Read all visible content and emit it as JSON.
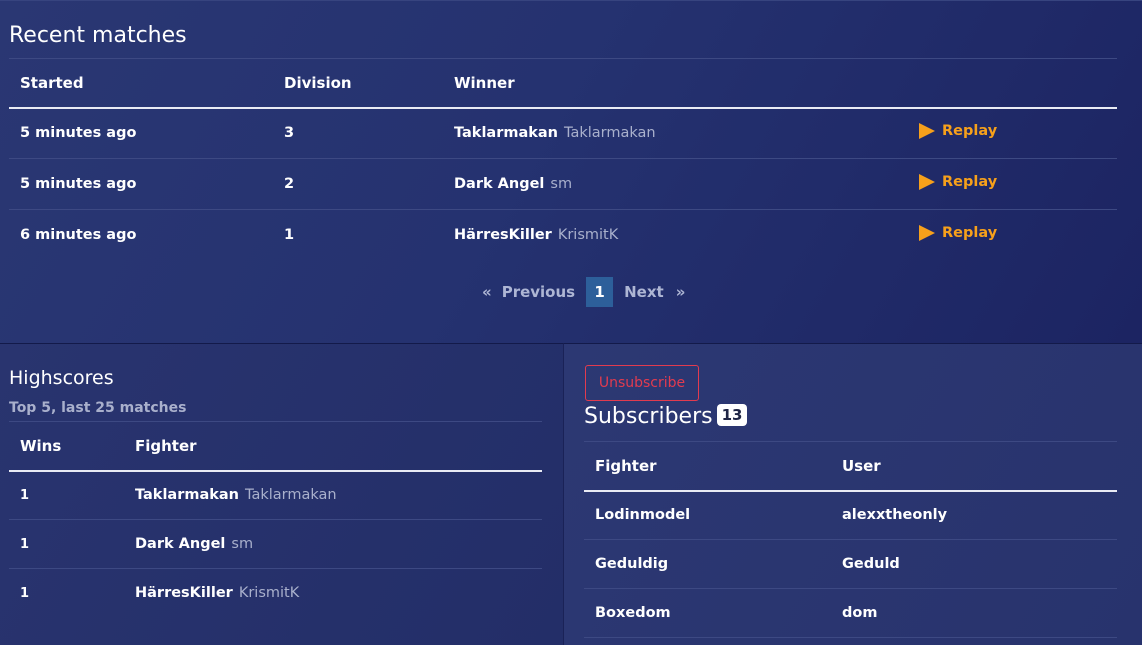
{
  "recent": {
    "title": "Recent matches",
    "columns": {
      "started": "Started",
      "division": "Division",
      "winner": "Winner"
    },
    "rows": [
      {
        "started": "5 minutes ago",
        "division": "3",
        "fighter": "Taklarmakan",
        "user": "Taklarmakan",
        "action": "Replay"
      },
      {
        "started": "5 minutes ago",
        "division": "2",
        "fighter": "Dark Angel",
        "user": "sm",
        "action": "Replay"
      },
      {
        "started": "6 minutes ago",
        "division": "1",
        "fighter": "HärresKiller",
        "user": "KrismitK",
        "action": "Replay"
      }
    ],
    "pagination": {
      "first": "«",
      "previous": "Previous",
      "current": "1",
      "next": "Next",
      "last": "»"
    }
  },
  "highscores": {
    "title": "Highscores",
    "subtitle": "Top 5, last 25 matches",
    "columns": {
      "wins": "Wins",
      "fighter": "Fighter"
    },
    "rows": [
      {
        "wins": "1",
        "fighter": "Taklarmakan",
        "user": "Taklarmakan"
      },
      {
        "wins": "1",
        "fighter": "Dark Angel",
        "user": "sm"
      },
      {
        "wins": "1",
        "fighter": "HärresKiller",
        "user": "KrismitK"
      }
    ]
  },
  "subscribers": {
    "button": "Unsubscribe",
    "title": "Subscribers",
    "count": "13",
    "columns": {
      "fighter": "Fighter",
      "user": "User"
    },
    "rows": [
      {
        "fighter": "Lodinmodel",
        "user": "alexxtheonly"
      },
      {
        "fighter": "Geduldig",
        "user": "Geduld"
      },
      {
        "fighter": "Boxedom",
        "user": "dom"
      }
    ]
  },
  "colors": {
    "background": "#253270",
    "accent": "#f6a01b",
    "danger": "#e23b4f",
    "active_page": "#2d5f9a",
    "muted_text": "#a9b0cc"
  },
  "icons": {
    "replay": "play-triangle-icon"
  }
}
